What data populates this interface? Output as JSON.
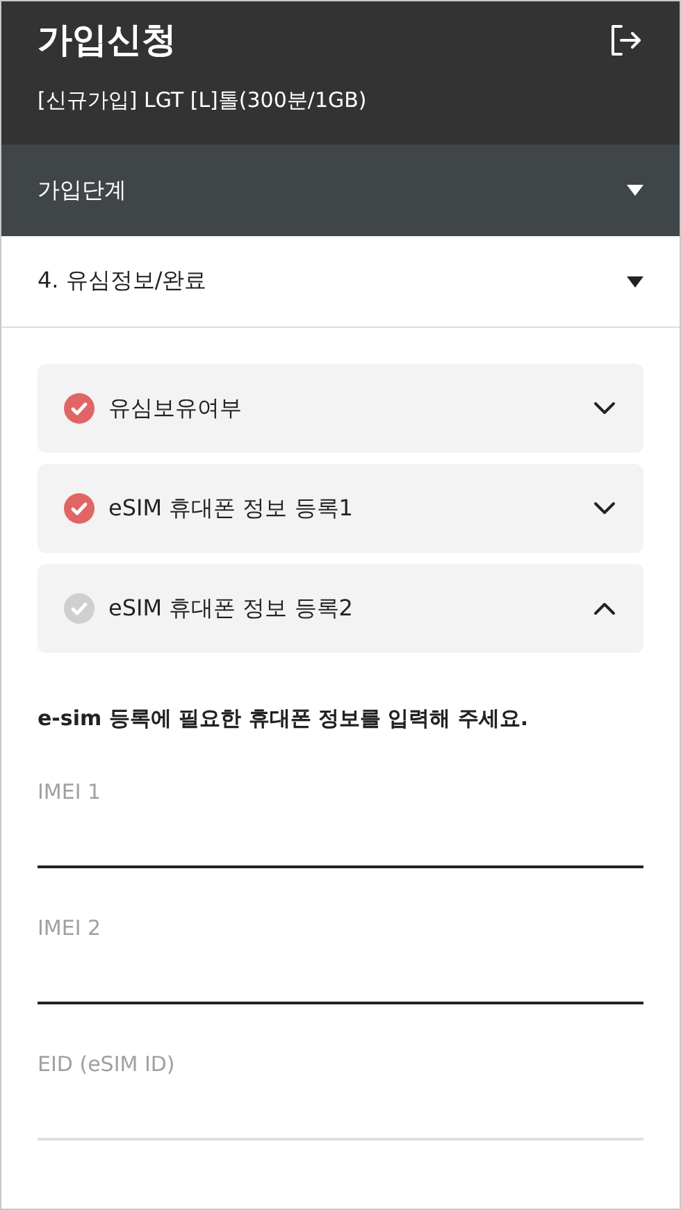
{
  "header": {
    "title": "가입신청",
    "subtitle": "[신규가입] LGT [L]톨(300분/1GB)"
  },
  "step_bar": {
    "label": "가입단계"
  },
  "step_select": {
    "value": "4. 유심정보/완료"
  },
  "sections": [
    {
      "title": "유심보유여부",
      "done": true,
      "expanded": false
    },
    {
      "title": "eSIM 휴대폰 정보 등록1",
      "done": true,
      "expanded": false
    },
    {
      "title": "eSIM 휴대폰 정보 등록2",
      "done": false,
      "expanded": true
    }
  ],
  "instruction": "e-sim 등록에 필요한 휴대폰 정보를 입력해 주세요.",
  "fields": [
    {
      "placeholder": "IMEI 1",
      "active": true
    },
    {
      "placeholder": "IMEI 2",
      "active": true
    },
    {
      "placeholder": "EID (eSIM ID)",
      "active": false
    }
  ]
}
